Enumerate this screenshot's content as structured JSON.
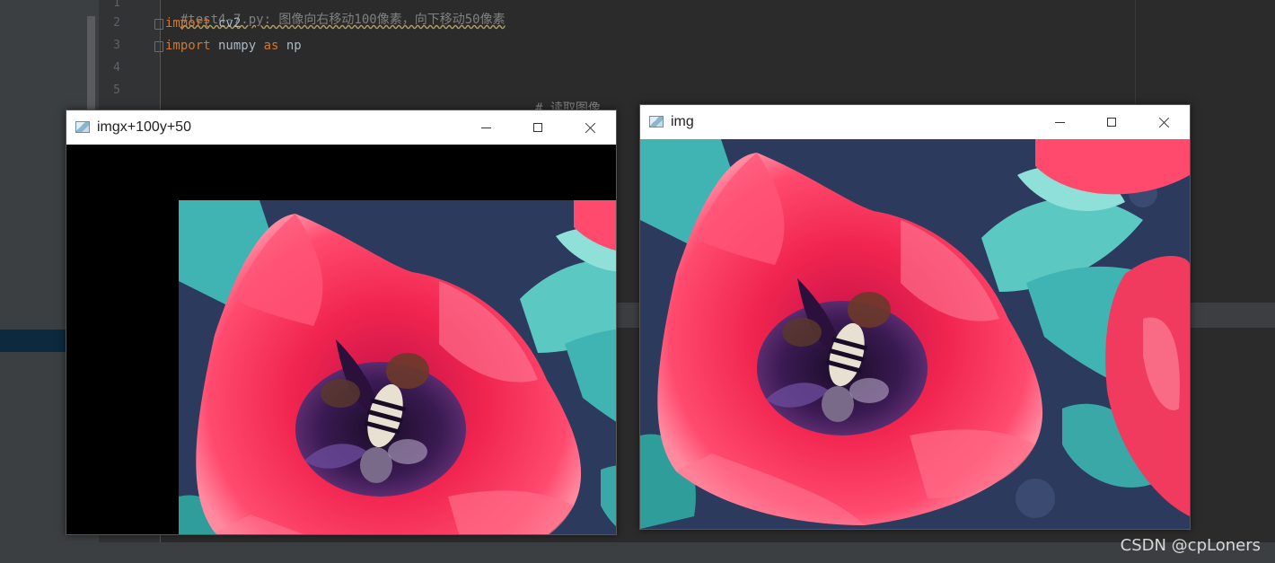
{
  "ide": {
    "line_numbers": [
      "1",
      "2",
      "3",
      "4",
      "5"
    ],
    "code_lines": [
      {
        "comment": "#test4-7.py: 图像向右移动100像素，向下移动50像素"
      },
      {
        "keyword": "import",
        "rest": " cv2"
      },
      {
        "keyword": "import",
        "rest": " numpy ",
        "keyword2": "as",
        "rest2": " np"
      }
    ],
    "comment_fragment": "# 读取图像"
  },
  "window_shifted": {
    "title": "imgx+100y+50",
    "icon": "app-window-icon",
    "controls": [
      "minimize",
      "maximize",
      "close"
    ]
  },
  "window_original": {
    "title": "img",
    "icon": "app-window-icon",
    "controls": [
      "minimize",
      "maximize",
      "close"
    ]
  },
  "image": {
    "subject": "red tulip with bee",
    "colors": {
      "petal": "#f0244f",
      "petal_light": "#ff6d88",
      "petal_dark": "#b5133d",
      "leaf": "#3fb4b3",
      "leaf_light": "#8fe0d8",
      "soil": "#2c3a5e",
      "center": "#2a103a",
      "bee_stripe": "#e8e0d0"
    }
  },
  "watermark": "CSDN @cpLoners"
}
